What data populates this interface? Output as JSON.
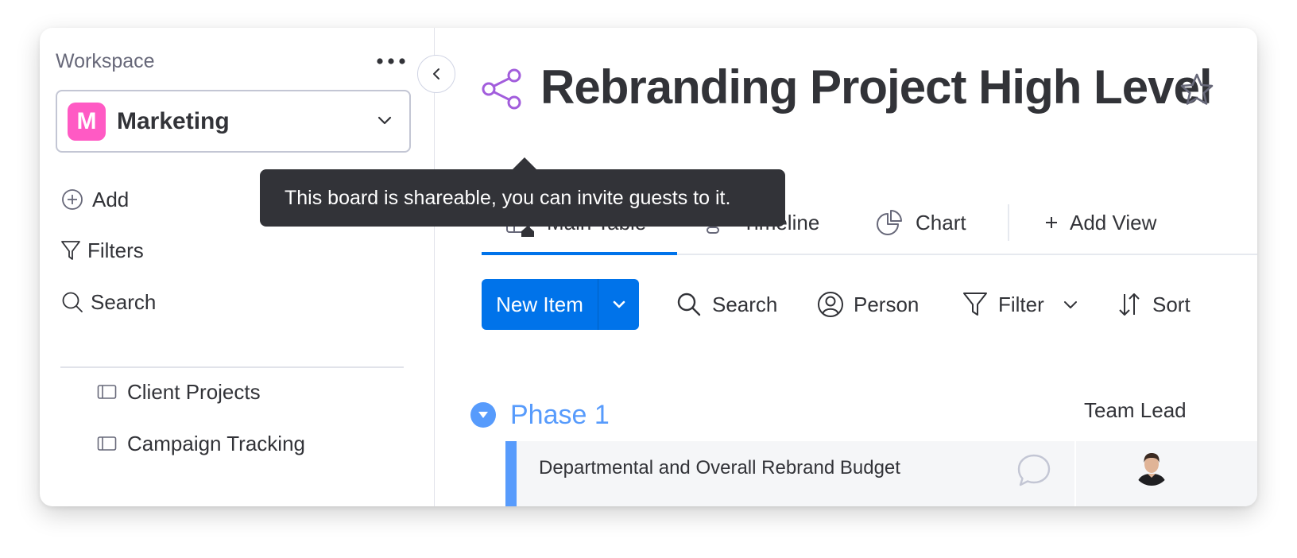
{
  "sidebar": {
    "workspace_label": "Workspace",
    "workspace": {
      "initial": "M",
      "name": "Marketing"
    },
    "actions": [
      {
        "label": "Add",
        "icon": "plus-circle-icon"
      },
      {
        "label": "Filters",
        "icon": "filter-icon"
      },
      {
        "label": "Search",
        "icon": "search-icon"
      }
    ],
    "boards": [
      {
        "label": "Client Projects",
        "icon": "board-icon"
      },
      {
        "label": "Campaign Tracking",
        "icon": "board-icon"
      }
    ]
  },
  "board": {
    "title": "Rebranding Project High Level"
  },
  "tooltip": {
    "text": "This board is shareable, you can invite guests to it."
  },
  "views": {
    "tabs": [
      {
        "label": "Main Table",
        "icon": "table-home-icon",
        "active": true
      },
      {
        "label": "Timeline",
        "icon": "timeline-icon",
        "active": false
      },
      {
        "label": "Chart",
        "icon": "pie-chart-icon",
        "active": false
      }
    ],
    "add_view_label": "Add View"
  },
  "toolbar": {
    "new_item_label": "New Item",
    "search_label": "Search",
    "person_label": "Person",
    "filter_label": "Filter",
    "sort_label": "Sort"
  },
  "group": {
    "title": "Phase 1",
    "color": "#579bfc",
    "columns": [
      "Team Lead"
    ],
    "rows": [
      {
        "name": "Departmental and Overall Rebrand Budget"
      }
    ]
  },
  "colors": {
    "primary": "#0073ea",
    "workspace_avatar": "#ff5ac4",
    "share_icon": "#a25ddc",
    "tooltip_bg": "#323338"
  }
}
